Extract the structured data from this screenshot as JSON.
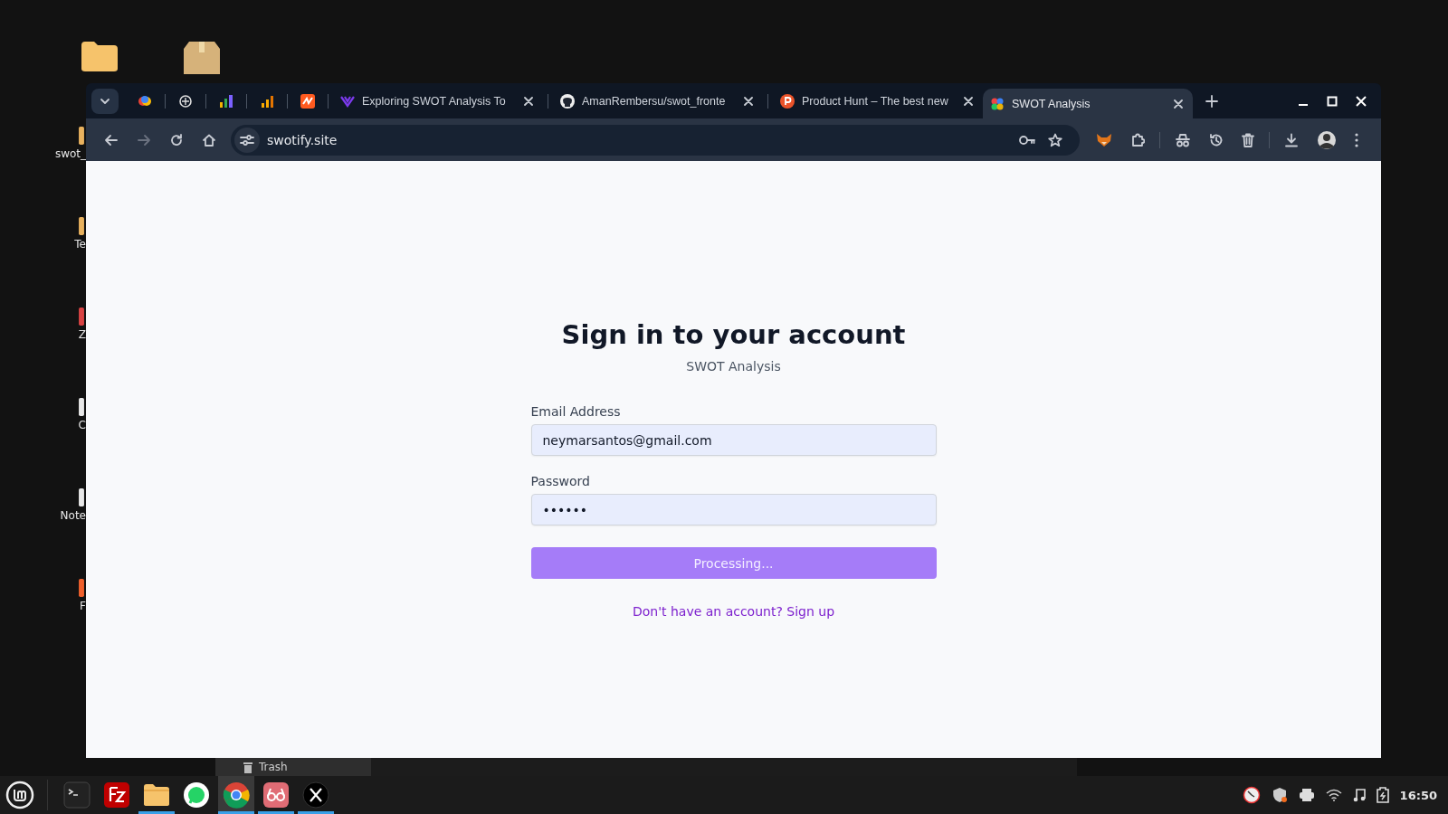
{
  "desktop": {
    "icons": [
      {
        "label": "swot_"
      },
      {
        "label": "Te"
      },
      {
        "label": "Z"
      },
      {
        "label": "C"
      },
      {
        "label": "Note"
      },
      {
        "label": "F"
      }
    ]
  },
  "background_window": {
    "item": "Trash"
  },
  "browser": {
    "pinned_tabs": [
      {
        "selected": false
      },
      {
        "selected": false
      },
      {
        "selected": false
      },
      {
        "selected": false
      },
      {
        "selected": false
      }
    ],
    "tabs": [
      {
        "title": "Exploring SWOT Analysis To",
        "selected": false
      },
      {
        "title": "AmanRembersu/swot_fronte",
        "selected": false
      },
      {
        "title": "Product Hunt – The best new",
        "selected": false
      },
      {
        "title": "SWOT Analysis",
        "selected": true
      }
    ],
    "address": "swotify.site",
    "page": {
      "title": "Sign in to your account",
      "subtitle": "SWOT Analysis",
      "fields": [
        {
          "label": "Email Address",
          "value": "neymarsantos@gmail.com"
        },
        {
          "label": "Password",
          "value": "••••••"
        }
      ],
      "submit": {
        "label": "Processing...",
        "disabled": true
      },
      "link": "Don't have an account? Sign up"
    }
  },
  "taskbar": {
    "apps": [
      {
        "running": false,
        "selected": false
      },
      {
        "running": false,
        "selected": false
      },
      {
        "running": true,
        "selected": false
      },
      {
        "running": false,
        "selected": false
      },
      {
        "running": true,
        "selected": true
      },
      {
        "running": true,
        "selected": false
      },
      {
        "running": true,
        "selected": false
      }
    ],
    "clock": "16:50"
  }
}
